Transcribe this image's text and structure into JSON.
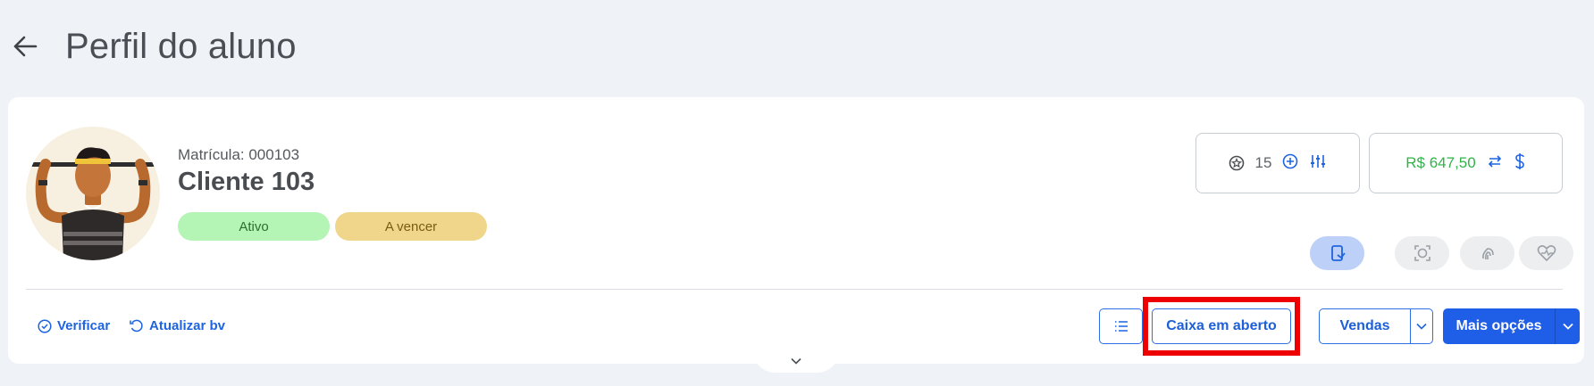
{
  "header": {
    "title": "Perfil do aluno"
  },
  "profile": {
    "matricula": "Matrícula: 000103",
    "name": "Cliente 103",
    "badges": [
      {
        "label": "Ativo",
        "color": "#b4f5b5"
      },
      {
        "label": "A vencer",
        "color": "#f0d68b"
      }
    ]
  },
  "points_box": {
    "value": "15"
  },
  "money_box": {
    "value": "R$ 647,50",
    "color": "#2fb34a"
  },
  "access_buttons": [
    {
      "icon": "mobile-checkin-icon",
      "active": true
    },
    {
      "icon": "face-recognition-icon",
      "active": false
    },
    {
      "icon": "fingerprint-icon",
      "active": false
    },
    {
      "icon": "heart-health-icon",
      "active": false
    }
  ],
  "actions": {
    "verificar": "Verificar",
    "atualizar": "Atualizar bv",
    "caixa": "Caixa em aberto",
    "vendas": "Vendas",
    "mais": "Mais opções"
  },
  "colors": {
    "accent": "#1f5ee6",
    "highlight": "#ee0000"
  }
}
